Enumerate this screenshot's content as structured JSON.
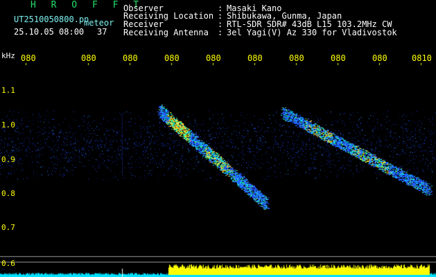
{
  "header": {
    "title": "H R O F F T",
    "filename": "UT2510050800.pn",
    "tag": "meteor",
    "datetime": "25.10.05 08:00",
    "count": "37",
    "fields": [
      {
        "key": "Observer",
        "value": "Masaki Kano"
      },
      {
        "key": "Receiving Location",
        "value": "Shibukawa, Gunma, Japan"
      },
      {
        "key": "Receiver",
        "value": "RTL-SDR SDR# 43dB L15 103.2MHz CW"
      },
      {
        "key": "Receiving Antenna",
        "value": "3el Yagi(V) Az 330 for Vladivostok"
      }
    ]
  },
  "axes": {
    "unit": "kHz",
    "time_ticks": [
      "080",
      "080",
      "080",
      "080",
      "080",
      "080",
      "080",
      "080",
      "080",
      "0810"
    ],
    "freq_ticks": [
      "1.1",
      "1.0",
      "0.9",
      "0.8",
      "0.7",
      "0.6"
    ]
  },
  "colors": {
    "background": "#000000",
    "noise": "#1a3cd0",
    "echo_core": "#ffb000",
    "bar_yellow": "#ffff00",
    "bar_cyan": "#00e0ff",
    "grid": "#9a9a9a"
  }
}
